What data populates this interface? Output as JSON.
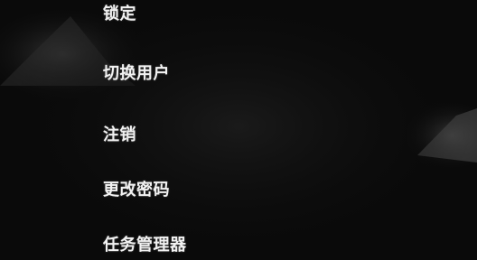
{
  "screen": {
    "background_color": "#0a0a0a",
    "text_color": "#f2f2f2"
  },
  "menu": {
    "items": [
      {
        "label": "锁定"
      },
      {
        "label": "切换用户"
      },
      {
        "label": "注销"
      },
      {
        "label": "更改密码"
      },
      {
        "label": "任务管理器"
      }
    ]
  }
}
